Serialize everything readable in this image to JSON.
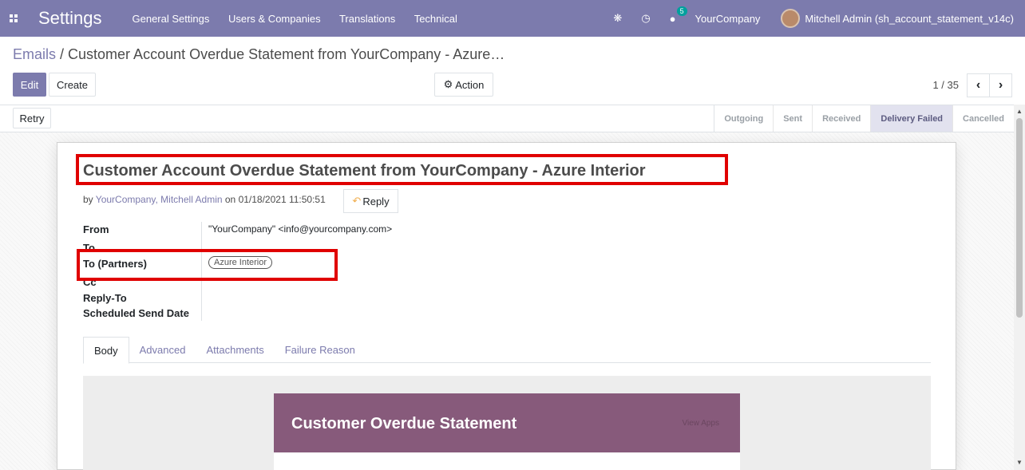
{
  "navbar": {
    "app_name": "Settings",
    "menu": [
      "General Settings",
      "Users & Companies",
      "Translations",
      "Technical"
    ],
    "message_count": "5",
    "company": "YourCompany",
    "user": "Mitchell Admin (sh_account_statement_v14c)"
  },
  "breadcrumb": {
    "parent": "Emails",
    "separator": " / ",
    "current": "Customer Account Overdue Statement from YourCompany - Azure…"
  },
  "buttons": {
    "edit": "Edit",
    "create": "Create",
    "action": "Action",
    "retry": "Retry",
    "reply": "Reply"
  },
  "pager": {
    "value": "1 / 35"
  },
  "stages": [
    {
      "label": "Outgoing",
      "active": false
    },
    {
      "label": "Sent",
      "active": false
    },
    {
      "label": "Received",
      "active": false
    },
    {
      "label": "Delivery Failed",
      "active": true
    },
    {
      "label": "Cancelled",
      "active": false
    }
  ],
  "message": {
    "subject": "Customer Account Overdue Statement from YourCompany - Azure Interior",
    "by_prefix": "by ",
    "authors": "YourCompany, Mitchell Admin",
    "date_text": " on 01/18/2021 11:50:51"
  },
  "fields": {
    "from_label": "From",
    "from_value": "\"YourCompany\" <info@yourcompany.com>",
    "to_label": "To",
    "to_partners_label": "To (Partners)",
    "to_partners_value": "Azure Interior",
    "cc_label": "Cc",
    "reply_to_label": "Reply-To",
    "scheduled_label": "Scheduled Send Date"
  },
  "tabs": [
    "Body",
    "Advanced",
    "Attachments",
    "Failure Reason"
  ],
  "email_preview": {
    "title": "Customer Overdue Statement",
    "link": "View Apps"
  },
  "colors": {
    "brand": "#7c7bad",
    "email_header": "#875a7b",
    "highlight": "#e00000"
  }
}
